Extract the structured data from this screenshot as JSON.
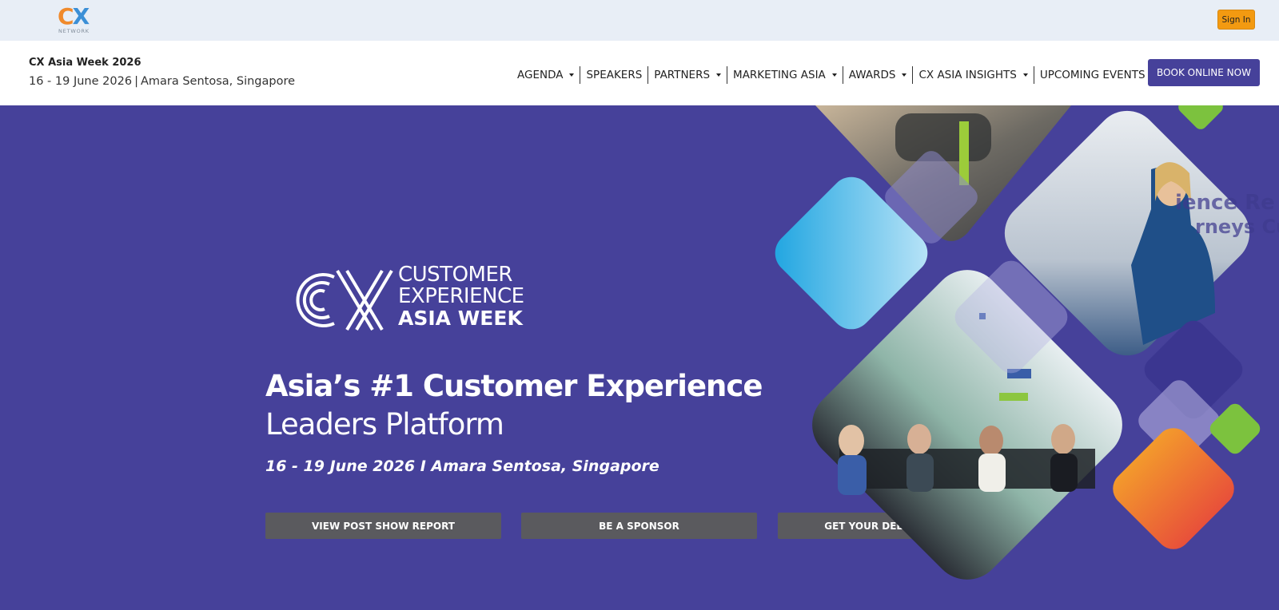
{
  "topbar": {
    "logo_text_c": "C",
    "logo_text_x": "X",
    "logo_sub": "NETWORK",
    "signin_label": "Sign In"
  },
  "header": {
    "event_name": "CX Asia Week 2026",
    "event_dates": "16 - 19 June 2026",
    "event_separator": "|",
    "event_venue": "Amara Sentosa, Singapore",
    "nav": [
      {
        "label": "AGENDA",
        "dropdown": true
      },
      {
        "label": "SPEAKERS",
        "dropdown": false
      },
      {
        "label": "PARTNERS",
        "dropdown": true
      },
      {
        "label": "MARKETING ASIA",
        "dropdown": true
      },
      {
        "label": "AWARDS",
        "dropdown": true
      },
      {
        "label": "CX ASIA INSIGHTS",
        "dropdown": true
      },
      {
        "label": "UPCOMING EVENTS",
        "dropdown": true
      }
    ],
    "book_label": "BOOK ONLINE NOW"
  },
  "hero": {
    "logo_line1": "CUSTOMER",
    "logo_line2": "EXPERIENCE",
    "logo_line3": "ASIA WEEK",
    "title_line1": "Asia’s #1 Customer Experience",
    "title_line2": "Leaders Platform",
    "date_venue": "16 - 19 June 2026 I Amara Sentosa, Singapore",
    "cta1": "VIEW POST SHOW REPORT",
    "cta2": "BE A SPONSOR",
    "cta3": "GET YOUR DELEGATE PASS"
  },
  "colors": {
    "topbar_bg": "#e8eef6",
    "hero_bg": "#46419a",
    "book_button": "#46419a",
    "signin_button": "#f39a11",
    "cta_button": "#5a5a5e"
  }
}
